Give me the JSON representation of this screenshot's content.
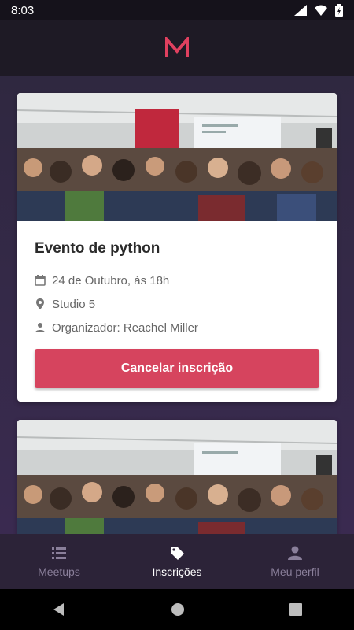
{
  "status_bar": {
    "time": "8:03"
  },
  "header": {
    "logo_letter": "M",
    "logo_color": "#e0405f"
  },
  "events": [
    {
      "title": "Evento de python",
      "date": "24 de Outubro, às 18h",
      "location": "Studio 5",
      "organizer": "Organizador: Reachel Miller",
      "action_label": "Cancelar inscrição"
    },
    {
      "title": ""
    }
  ],
  "bottom_nav": {
    "items": [
      {
        "label": "Meetups",
        "icon": "list-icon",
        "active": false
      },
      {
        "label": "Inscrições",
        "icon": "tag-icon",
        "active": true
      },
      {
        "label": "Meu perfil",
        "icon": "person-icon",
        "active": false
      }
    ]
  },
  "colors": {
    "accent": "#d6445e",
    "header_bg": "#1e1a25",
    "nav_bg": "#2c2338"
  }
}
